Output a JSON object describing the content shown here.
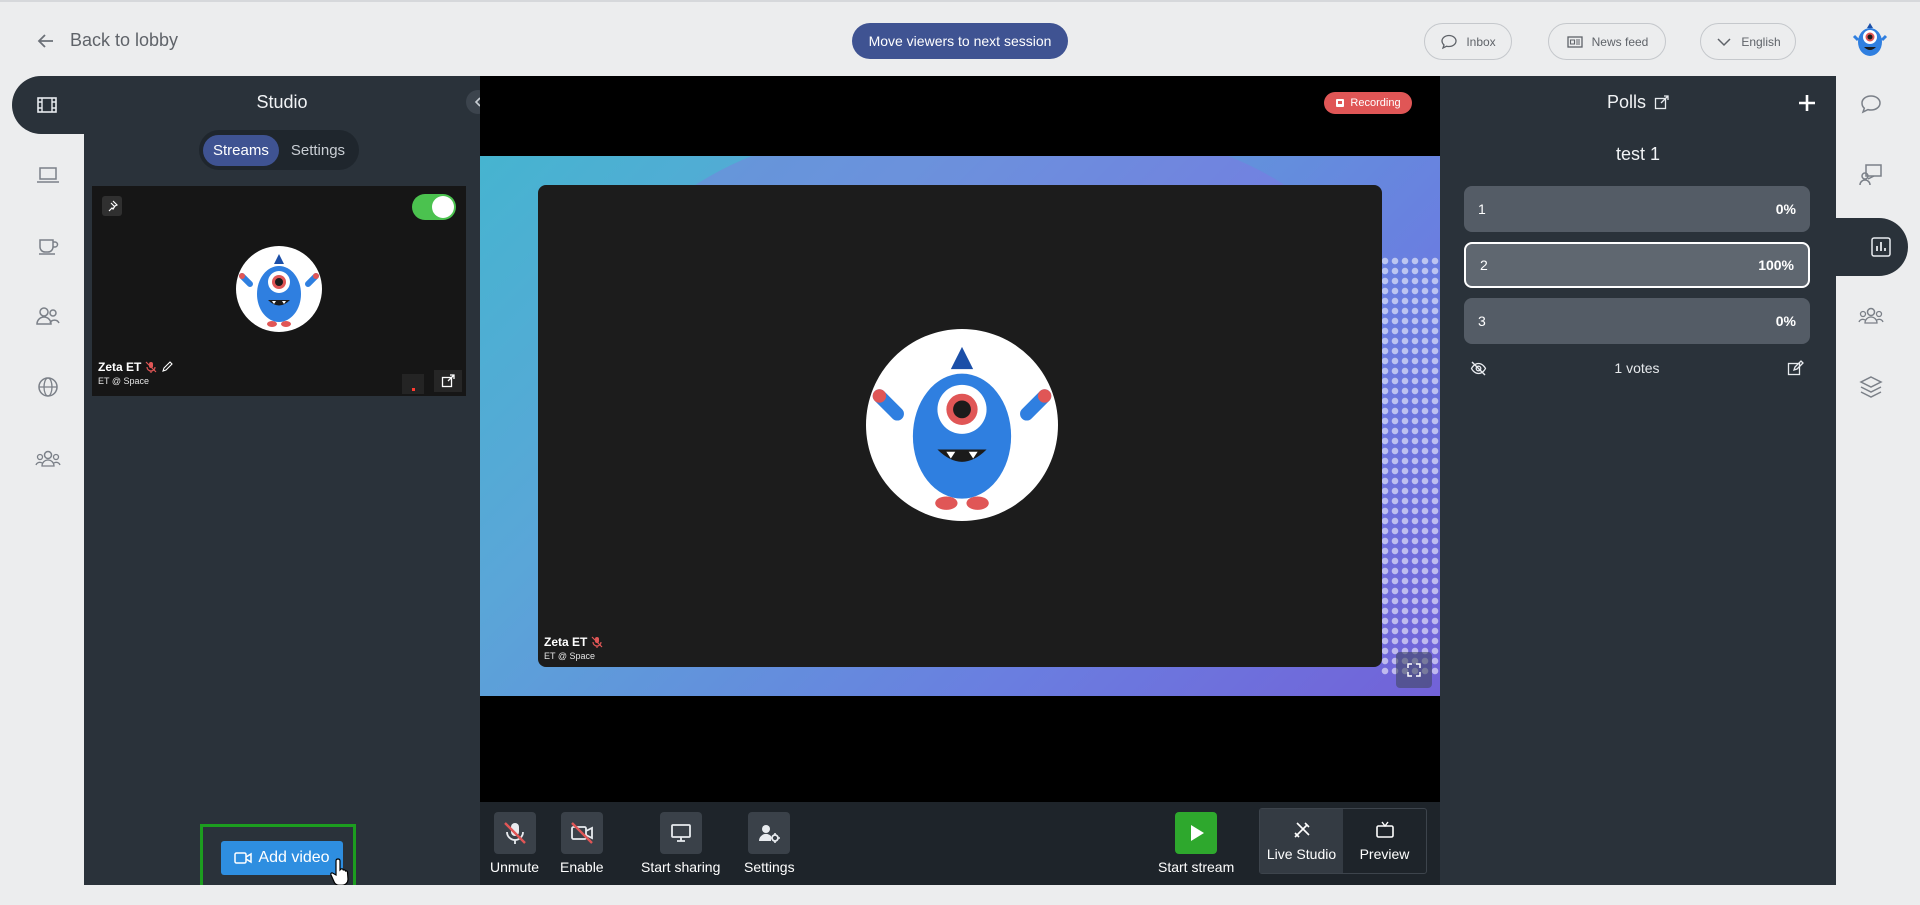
{
  "topbar": {
    "back_label": "Back to lobby",
    "move_label": "Move viewers to next session",
    "inbox_label": "Inbox",
    "newsfeed_label": "News feed",
    "language_label": "English"
  },
  "studio": {
    "title": "Studio",
    "tabs": [
      "Streams",
      "Settings"
    ],
    "stream": {
      "name": "Zeta ET",
      "subtitle": "ET @ Space",
      "enabled": true
    },
    "add_video_label": "Add video"
  },
  "stage": {
    "recording_label": "Recording",
    "speaker_name": "Zeta ET",
    "speaker_subtitle": "ET @ Space"
  },
  "controls": {
    "unmute": "Unmute",
    "enable": "Enable",
    "start_sharing": "Start sharing",
    "settings": "Settings",
    "start_stream": "Start stream",
    "live_studio": "Live Studio",
    "preview": "Preview"
  },
  "polls": {
    "title": "Polls",
    "question": "test 1",
    "options": [
      {
        "label": "1",
        "percent": "0%",
        "selected": false
      },
      {
        "label": "2",
        "percent": "100%",
        "selected": true
      },
      {
        "label": "3",
        "percent": "0%",
        "selected": false
      }
    ],
    "votes_label": "1 votes"
  },
  "colors": {
    "accent": "#3f5392",
    "panel": "#2a323a",
    "recording": "#e05656",
    "start_stream": "#2ea82d",
    "add_video": "#2e8ee0",
    "highlight_box": "#1c9d1f"
  }
}
